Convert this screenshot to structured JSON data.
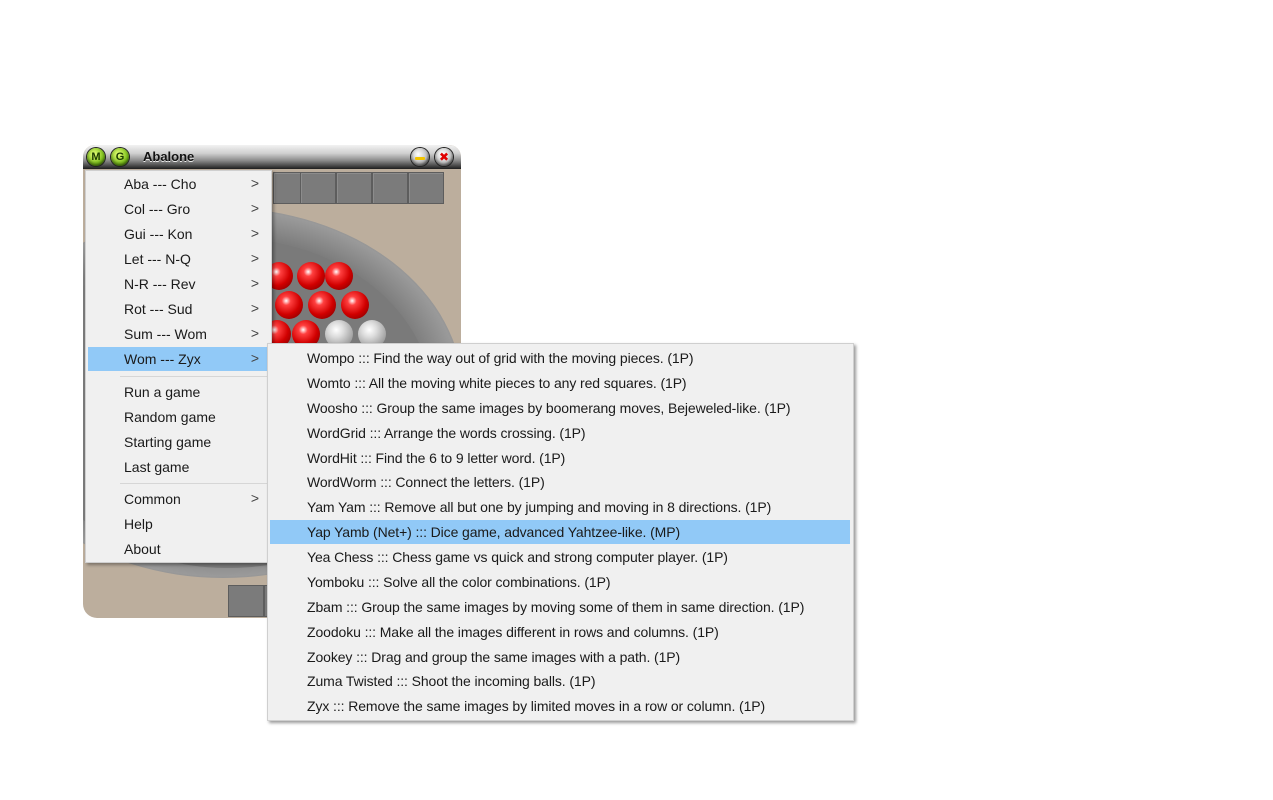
{
  "window": {
    "title": "Abalone",
    "buttons": {
      "m_label": "M",
      "g_label": "G",
      "close_glyph": "✖"
    }
  },
  "menu": {
    "groups": [
      {
        "label": "Aba --- Cho",
        "submenu": true
      },
      {
        "label": "Col --- Gro",
        "submenu": true
      },
      {
        "label": "Gui --- Kon",
        "submenu": true
      },
      {
        "label": "Let --- N-Q",
        "submenu": true
      },
      {
        "label": "N-R --- Rev",
        "submenu": true
      },
      {
        "label": "Rot --- Sud",
        "submenu": true
      },
      {
        "label": "Sum --- Wom",
        "submenu": true
      },
      {
        "label": "Wom --- Zyx",
        "submenu": true,
        "highlighted": true
      }
    ],
    "actions": [
      {
        "label": "Run a game"
      },
      {
        "label": "Random game"
      },
      {
        "label": "Starting game"
      },
      {
        "label": "Last game"
      }
    ],
    "other": [
      {
        "label": "Common",
        "submenu": true
      },
      {
        "label": "Help"
      },
      {
        "label": "About"
      }
    ],
    "arrow_glyph": ">"
  },
  "submenu": {
    "items": [
      {
        "label": "Wompo ::: Find the way out of grid with the moving pieces. (1P)"
      },
      {
        "label": "Womto ::: All the moving white pieces to any red squares. (1P)"
      },
      {
        "label": "Woosho ::: Group the same images by boomerang moves, Bejeweled-like. (1P)"
      },
      {
        "label": "WordGrid ::: Arrange the words crossing. (1P)"
      },
      {
        "label": "WordHit ::: Find the 6 to 9 letter word. (1P)"
      },
      {
        "label": "WordWorm ::: Connect the letters. (1P)"
      },
      {
        "label": "Yam Yam ::: Remove all but one by jumping and moving in 8 directions. (1P)"
      },
      {
        "label": "Yap Yamb (Net+) ::: Dice game, advanced Yahtzee-like. (MP)",
        "highlighted": true
      },
      {
        "label": "Yea Chess ::: Chess game vs quick and strong computer player. (1P)"
      },
      {
        "label": "Yomboku ::: Solve all the color combinations. (1P)"
      },
      {
        "label": "Zbam ::: Group the same images by moving some of them in same direction. (1P)"
      },
      {
        "label": "Zoodoku ::: Make all the images different in rows and columns. (1P)"
      },
      {
        "label": "Zookey ::: Drag and group the same images with a path. (1P)"
      },
      {
        "label": "Zuma Twisted ::: Shoot the incoming balls. (1P)"
      },
      {
        "label": "Zyx ::: Remove the same images by limited moves in a row or column. (1P)"
      }
    ]
  },
  "colors": {
    "highlight": "#91c9f7",
    "menu_bg": "#f0f0f0",
    "window_bg": "#bcae9d"
  }
}
